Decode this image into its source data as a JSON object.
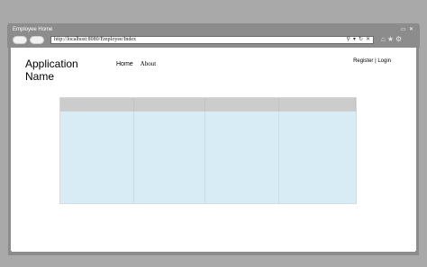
{
  "window": {
    "title": "Employee Home",
    "controls": "▭ ✕"
  },
  "browser": {
    "url": "http://localhost:8080/Employee/Index",
    "address_icons": [
      "search-icon",
      "dropdown-icon",
      "refresh-icon",
      "close-icon"
    ],
    "tool_icons": [
      "home-icon",
      "star-icon",
      "gear-icon"
    ]
  },
  "page": {
    "app_name": "Application Name",
    "nav": {
      "home": "Home",
      "about": "About"
    },
    "auth": "Register | Login"
  },
  "table": {
    "columns": [
      "",
      "",
      "",
      ""
    ],
    "rows": [
      [
        "",
        "",
        "",
        ""
      ]
    ]
  },
  "colors": {
    "chrome": "#8c8c8c",
    "table_header": "#cccccc",
    "table_body": "#d8ecf6"
  }
}
